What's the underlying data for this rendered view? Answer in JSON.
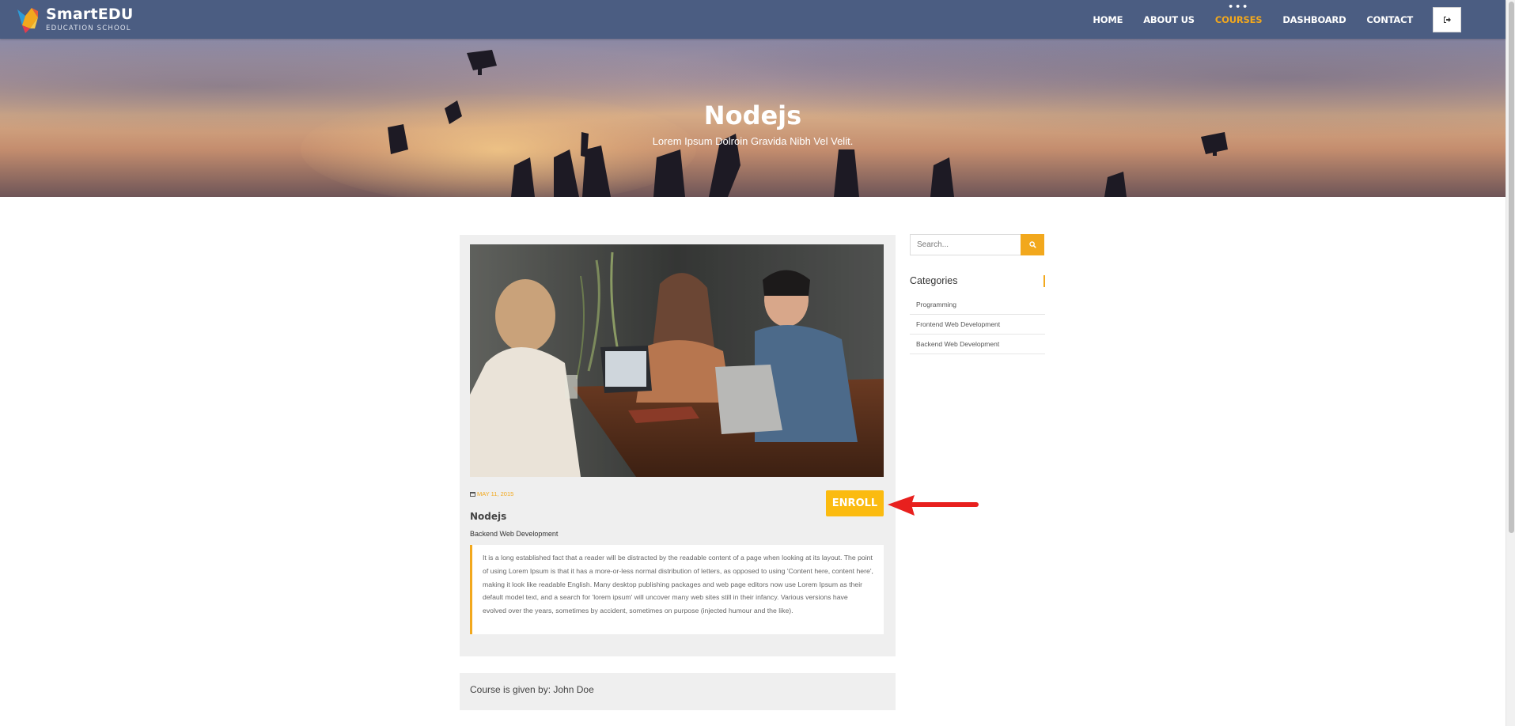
{
  "brand": {
    "title": "SmartEDU",
    "subtitle": "EDUCATION SCHOOL",
    "accent": "#f2a81d",
    "nav_bg": "#4b5d82"
  },
  "nav": {
    "items": [
      {
        "label": "HOME",
        "active": false
      },
      {
        "label": "ABOUT US",
        "active": false
      },
      {
        "label": "COURSES",
        "active": true
      },
      {
        "label": "DASHBOARD",
        "active": false
      },
      {
        "label": "CONTACT",
        "active": false
      }
    ],
    "logout_icon": "sign-out-icon"
  },
  "hero": {
    "title": "Nodejs",
    "subtitle": "Lorem Ipsum Dolroin Gravida Nibh Vel Velit."
  },
  "course": {
    "date": "MAY 11, 2015",
    "enroll_label": "ENROLL",
    "title": "Nodejs",
    "category": "Backend Web Development",
    "description": "It is a long established fact that a reader will be distracted by the readable content of a page when looking at its layout. The point of using Lorem Ipsum is that it has a more-or-less normal distribution of letters, as opposed to using 'Content here, content here', making it look like readable English. Many desktop publishing packages and web page editors now use Lorem Ipsum as their default model text, and a search for 'lorem ipsum' will uncover many web sites still in their infancy. Various versions have evolved over the years, sometimes by accident, sometimes on purpose (injected humour and the like).",
    "author_line": "Course is given by: John Doe"
  },
  "sidebar": {
    "search_placeholder": "Search...",
    "categories_heading": "Categories",
    "categories": [
      "Programming",
      "Frontend Web Development",
      "Backend Web Development"
    ]
  },
  "annotation": {
    "arrow_color": "#e8201e"
  }
}
